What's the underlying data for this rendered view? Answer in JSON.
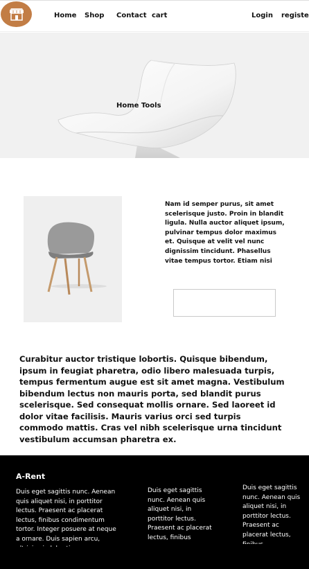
{
  "nav": {
    "logo_icon": "storefront-icon",
    "brand_color": "#c27d45",
    "links": {
      "home": "Home",
      "shop": "Shop",
      "contact": "Contact",
      "cart": "cart",
      "login": "Login",
      "register": "register"
    }
  },
  "hero": {
    "title": "Home Tools",
    "background": "#f1f1f1"
  },
  "product": {
    "description": "Nam id semper purus, sit amet scelerisque justo. Proin in blandit ligula. Nulla auctor aliquet ipsum, pulvinar tempus dolor maximus et. Quisque at velit vel nunc dignissim tincidunt. Phasellus vitae tempus tortor. Etiam nisi risus, tempus sit amet"
  },
  "body_paragraph": "Curabitur auctor tristique lobortis. Quisque bibendum, ipsum in feugiat pharetra, odio libero malesuada turpis, tempus fermentum augue est sit amet magna. Vestibulum bibendum lectus non mauris porta, sed blandit purus scelerisque. Sed consequat mollis ornare. Sed laoreet id dolor vitae facilisis. Mauris varius orci sed turpis commodo mattis. Cras vel nibh scelerisque urna tincidunt vestibulum accumsan pharetra ex.",
  "footer": {
    "brand": "A-Rent",
    "col1": "Duis eget sagittis nunc. Aenean quis aliquet nisi, in porttitor lectus. Praesent ac placerat lectus, finibus condimentum tortor. Integer posuere at neque a ornare. Duis sapien arcu, ultricies in lobortis",
    "col2": "Duis eget sagittis nunc. Aenean quis aliquet nisi, in porttitor lectus. Praesent ac placerat lectus, finibus",
    "col3": "Duis eget sagittis nunc. Aenean quis aliquet nisi, in porttitor lectus. Praesent ac placerat lectus, finibus"
  }
}
